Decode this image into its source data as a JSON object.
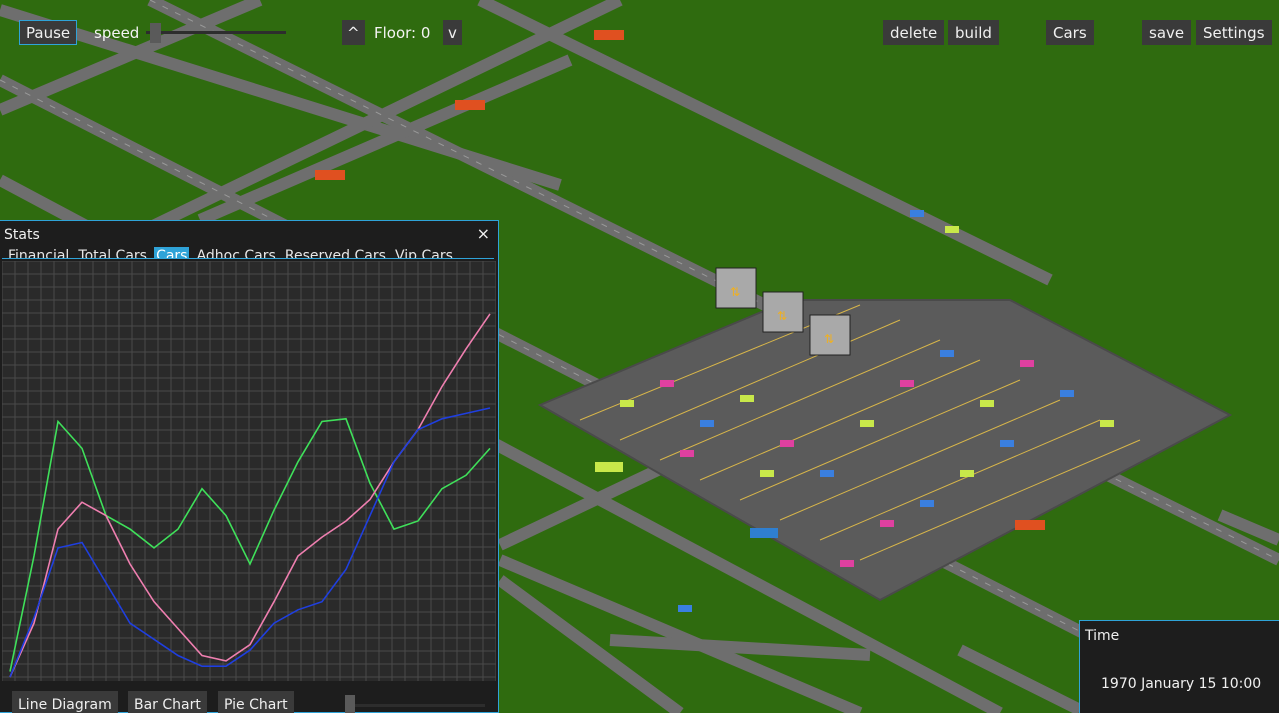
{
  "toolbar": {
    "pause_label": "Pause",
    "speed_label": "speed",
    "speed_value": 0.03,
    "floor_up_label": "^",
    "floor_label": "Floor: 0",
    "floor_down_label": "v",
    "delete_label": "delete",
    "build_label": "build",
    "cars_label": "Cars",
    "save_label": "save",
    "settings_label": "Settings"
  },
  "stats": {
    "title": "Stats",
    "close_label": "×",
    "tabs": [
      {
        "label": "Financial"
      },
      {
        "label": "Total Cars"
      },
      {
        "label": "Cars"
      },
      {
        "label": "Adhoc Cars"
      },
      {
        "label": "Reserved Cars"
      },
      {
        "label": "Vip Cars"
      }
    ],
    "active_tab": "Cars",
    "buttons": {
      "line": "Line Diagram",
      "bar": "Bar Chart",
      "pie": "Pie Chart"
    }
  },
  "time": {
    "title": "Time",
    "value": "1970 January 15 10:00"
  },
  "colors": {
    "grass": "#2f6b0f",
    "road": "#6e6e6e",
    "panel_bg": "#1d1d1d",
    "accent": "#2fa3d8",
    "series_green": "#3fe05a",
    "series_pink": "#ef7fb0",
    "series_blue": "#1f3fe0"
  },
  "signs": {
    "exit": "EXIT",
    "entry": "ENTRY"
  },
  "chart_data": {
    "type": "line",
    "x": [
      0,
      5,
      10,
      15,
      20,
      25,
      30,
      35,
      40,
      45,
      50,
      55,
      60,
      65,
      70,
      75,
      80,
      85,
      90,
      95,
      100
    ],
    "series": [
      {
        "color": "#3fe05a",
        "values": [
          2,
          45,
          95,
          85,
          60,
          55,
          48,
          55,
          70,
          60,
          42,
          62,
          80,
          95,
          96,
          72,
          55,
          58,
          70,
          75,
          85
        ]
      },
      {
        "color": "#ef7fb0",
        "values": [
          0,
          20,
          55,
          65,
          60,
          42,
          28,
          18,
          8,
          6,
          12,
          28,
          45,
          52,
          58,
          66,
          80,
          92,
          108,
          122,
          135
        ]
      },
      {
        "color": "#1f3fe0",
        "values": [
          0,
          22,
          48,
          50,
          35,
          20,
          14,
          8,
          4,
          4,
          10,
          20,
          25,
          28,
          40,
          60,
          80,
          92,
          96,
          98,
          100
        ]
      }
    ]
  }
}
